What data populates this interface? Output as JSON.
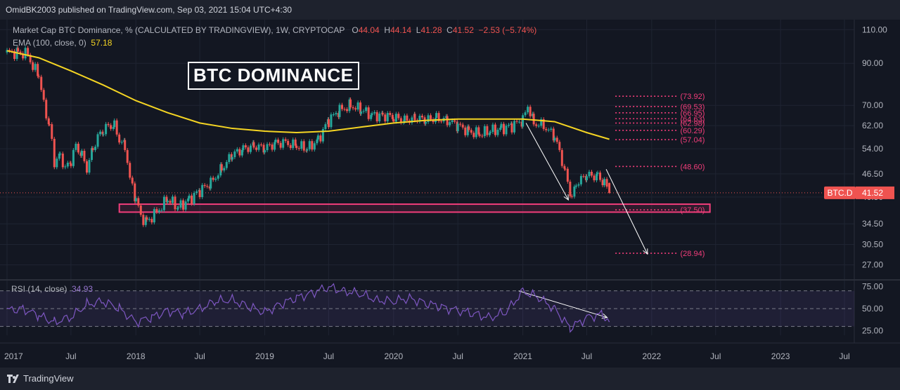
{
  "header": {
    "published": "OmidBK2003 published on TradingView.com, Sep 03, 2021 15:04 UTC+4:30"
  },
  "legend": {
    "symbol": "Market Cap BTC Dominance, % (CALCULATED BY TRADINGVIEW), 1W, CRYPTOCAP",
    "o_label": "O",
    "o": "44.04",
    "h_label": "H",
    "h": "44.14",
    "l_label": "L",
    "l": "41.28",
    "c_label": "C",
    "c": "41.52",
    "change": "−2.53 (−5.74%)",
    "ema_label": "EMA (100, close, 0)",
    "ema_value": "57.18"
  },
  "annotation_title": "BTC DOMINANCE",
  "rsi_legend": {
    "label": "RSI (14, close)",
    "value": "34.93"
  },
  "footer": {
    "brand": "TradingView"
  },
  "colors": {
    "background": "#131722",
    "up": "#26a69a",
    "down": "#ef5350",
    "ema": "#f5d523",
    "fib": "#f23d7a",
    "rsi": "#7e57c2"
  },
  "chart_data": {
    "type": "line",
    "scale": "log",
    "ylim": [
      25.0,
      112.0
    ],
    "y_ticks": [
      "110.00",
      "90.00",
      "70.00",
      "62.00",
      "54.00",
      "46.50",
      "40.50",
      "34.50",
      "30.50",
      "27.00"
    ],
    "x_ticks": [
      "2017",
      "Jul",
      "2018",
      "Jul",
      "2019",
      "Jul",
      "2020",
      "Jul",
      "2021",
      "Jul",
      "2022",
      "Jul",
      "2023",
      "Jul"
    ],
    "x_tick_dates": [
      "2017-01-01",
      "2017-07-01",
      "2018-01-01",
      "2018-07-01",
      "2019-01-01",
      "2019-07-01",
      "2020-01-01",
      "2020-07-01",
      "2021-01-01",
      "2021-07-01",
      "2022-01-01",
      "2022-07-01",
      "2023-01-01",
      "2023-07-01"
    ],
    "price_label": {
      "name": "BTC.D",
      "value": "41.52"
    },
    "series": [
      {
        "name": "Market Cap BTC Dominance",
        "dates": [
          "2017-01-01",
          "2017-02-01",
          "2017-03-01",
          "2017-03-15",
          "2017-04-01",
          "2017-04-15",
          "2017-05-01",
          "2017-05-15",
          "2017-06-01",
          "2017-06-15",
          "2017-07-01",
          "2017-07-15",
          "2017-08-01",
          "2017-08-15",
          "2017-09-01",
          "2017-09-15",
          "2017-10-01",
          "2017-10-15",
          "2017-11-01",
          "2017-11-15",
          "2017-12-01",
          "2017-12-15",
          "2018-01-01",
          "2018-01-15",
          "2018-02-01",
          "2018-03-01",
          "2018-04-01",
          "2018-05-01",
          "2018-06-01",
          "2018-07-01",
          "2018-08-01",
          "2018-09-01",
          "2018-10-01",
          "2018-11-01",
          "2018-12-01",
          "2019-01-01",
          "2019-02-01",
          "2019-03-01",
          "2019-04-01",
          "2019-05-01",
          "2019-06-01",
          "2019-07-01",
          "2019-08-01",
          "2019-09-01",
          "2019-10-01",
          "2019-11-01",
          "2019-12-01",
          "2020-01-01",
          "2020-02-01",
          "2020-03-01",
          "2020-04-01",
          "2020-05-01",
          "2020-06-01",
          "2020-07-01",
          "2020-08-01",
          "2020-09-01",
          "2020-10-01",
          "2020-11-01",
          "2020-12-01",
          "2021-01-01",
          "2021-01-15",
          "2021-02-01",
          "2021-03-01",
          "2021-04-01",
          "2021-05-01",
          "2021-05-20",
          "2021-06-01",
          "2021-07-01",
          "2021-08-01",
          "2021-08-20",
          "2021-09-03"
        ],
        "values": [
          96,
          96,
          95,
          88,
          84,
          70,
          62,
          50,
          52,
          48,
          50,
          55,
          52,
          48,
          54,
          58,
          60,
          62,
          62,
          57,
          55,
          45,
          40,
          36,
          35,
          37,
          40,
          38,
          40,
          42,
          44,
          48,
          52,
          54,
          55,
          54,
          56,
          56,
          55,
          54,
          57,
          64,
          68,
          70,
          68,
          66,
          66,
          65,
          64,
          65,
          64,
          65,
          64,
          62,
          60,
          59,
          60,
          61,
          62,
          64,
          70,
          63,
          62,
          58,
          47,
          40,
          44,
          46,
          46,
          44,
          41.52
        ]
      },
      {
        "name": "EMA (100, close, 0)",
        "dates": [
          "2017-01-01",
          "2017-04-01",
          "2017-07-01",
          "2017-10-01",
          "2018-01-01",
          "2018-04-01",
          "2018-07-01",
          "2018-10-01",
          "2019-01-01",
          "2019-04-01",
          "2019-07-01",
          "2019-10-01",
          "2020-01-01",
          "2020-04-01",
          "2020-07-01",
          "2020-10-01",
          "2021-01-01",
          "2021-04-01",
          "2021-07-01",
          "2021-09-03"
        ],
        "values": [
          97,
          93,
          86,
          79,
          72,
          67,
          63,
          61,
          60,
          59.5,
          60,
          61.5,
          63,
          64,
          64.5,
          64.5,
          64.5,
          63.5,
          59.5,
          57.18
        ]
      }
    ],
    "fib_levels": [
      "(73.92)",
      "(69.53)",
      "(66.95)",
      "(64.63)",
      "(62.98)",
      "(60.29)",
      "(57.04)",
      "(48.60)",
      "(37.50)",
      "(28.94)"
    ],
    "fib_values": [
      73.92,
      69.53,
      66.95,
      64.63,
      62.98,
      60.29,
      57.04,
      48.6,
      37.5,
      28.94
    ],
    "zone": {
      "from": "2017-11-15",
      "to": "2022-06-15",
      "low": 37.0,
      "high": 38.8
    },
    "rsi": {
      "name": "RSI (14, close)",
      "ylim": [
        20,
        80
      ],
      "y_ticks": [
        "75.00",
        "50.00",
        "25.00"
      ],
      "bands": [
        70,
        50,
        30
      ],
      "dates": [
        "2017-01-01",
        "2017-02-15",
        "2017-04-01",
        "2017-05-15",
        "2017-07-01",
        "2017-08-15",
        "2017-10-01",
        "2017-11-15",
        "2018-01-01",
        "2018-02-15",
        "2018-04-01",
        "2018-05-15",
        "2018-07-01",
        "2018-08-15",
        "2018-10-01",
        "2018-11-15",
        "2019-01-01",
        "2019-02-15",
        "2019-04-01",
        "2019-05-15",
        "2019-07-01",
        "2019-08-15",
        "2019-10-01",
        "2019-11-15",
        "2020-01-01",
        "2020-02-15",
        "2020-04-01",
        "2020-05-15",
        "2020-07-01",
        "2020-08-15",
        "2020-10-01",
        "2020-11-15",
        "2021-01-01",
        "2021-02-15",
        "2021-04-01",
        "2021-05-15",
        "2021-07-01",
        "2021-08-15",
        "2021-09-03"
      ],
      "values": [
        48,
        50,
        42,
        35,
        40,
        55,
        58,
        50,
        35,
        40,
        48,
        44,
        50,
        58,
        60,
        52,
        46,
        55,
        62,
        68,
        74,
        70,
        66,
        60,
        58,
        62,
        56,
        52,
        48,
        44,
        40,
        46,
        70,
        62,
        50,
        28,
        40,
        44,
        34.93
      ]
    }
  }
}
